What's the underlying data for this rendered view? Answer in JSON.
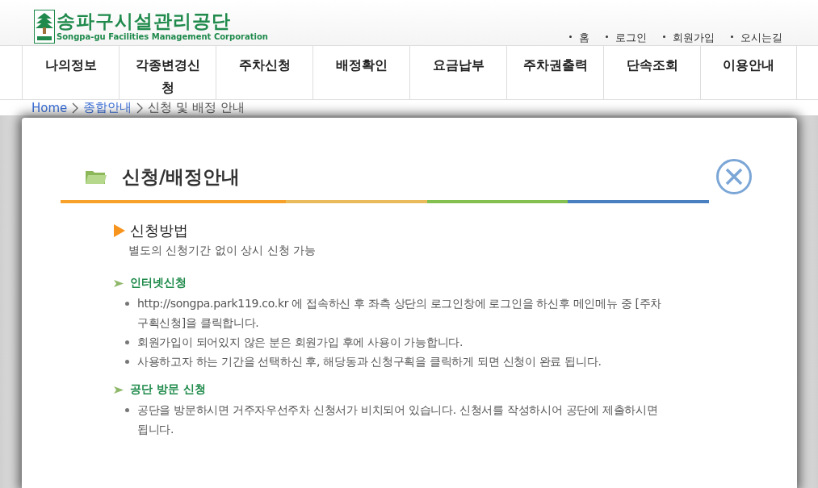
{
  "header": {
    "logo": {
      "name": "송파구시설관리공단",
      "subtitle": "Songpa-gu Facilities Management Corporation"
    },
    "top_links": [
      "홈",
      "로그인",
      "회원가입",
      "오시는길"
    ]
  },
  "nav": {
    "items": [
      {
        "label": "나의정보"
      },
      {
        "label": "각종변경신청"
      },
      {
        "label": "주차신청"
      },
      {
        "label": "배정확인"
      },
      {
        "label": "요금납부"
      },
      {
        "label": "주차권출력"
      },
      {
        "label": "단속조회"
      },
      {
        "label": "이용안내"
      }
    ]
  },
  "breadcrumb": [
    {
      "label": "Home",
      "kind": "link"
    },
    {
      "label": "종합안내",
      "kind": "link"
    },
    {
      "label": "신청 및 배정 안내",
      "kind": "current"
    }
  ],
  "modal": {
    "title": "신청/배정안내",
    "rule_segments": [
      {
        "color": "#f7a12b"
      },
      {
        "color": "#e9bb5a"
      },
      {
        "color": "#84c04f"
      },
      {
        "color": "#4a80c0"
      }
    ],
    "section": {
      "title": "신청방법",
      "description": "별도의 신청기간 없이 상시 신청 가능",
      "subsections": [
        {
          "title": "인터넷신청",
          "bullets": [
            "http://songpa.park119.co.kr 에 접속하신 후 좌측 상단의 로그인창에 로그인을 하신후 메인메뉴 중 [주차구획신청]을 클릭합니다.",
            "회원가입이 되어있지 않은 분은 회원가입 후에 사용이 가능합니다.",
            "사용하고자 하는 기간을 선택하신 후, 해당동과 신청구획을 클릭하게 되면 신청이 완료 됩니다."
          ]
        },
        {
          "title": "공단 방문 신청",
          "bullets": [
            "공단을 방문하시면 거주자우선주차 신청서가 비치되어 있습니다. 신청서를 작성하시어 공단에 제출하시면 됩니다."
          ]
        }
      ]
    }
  }
}
